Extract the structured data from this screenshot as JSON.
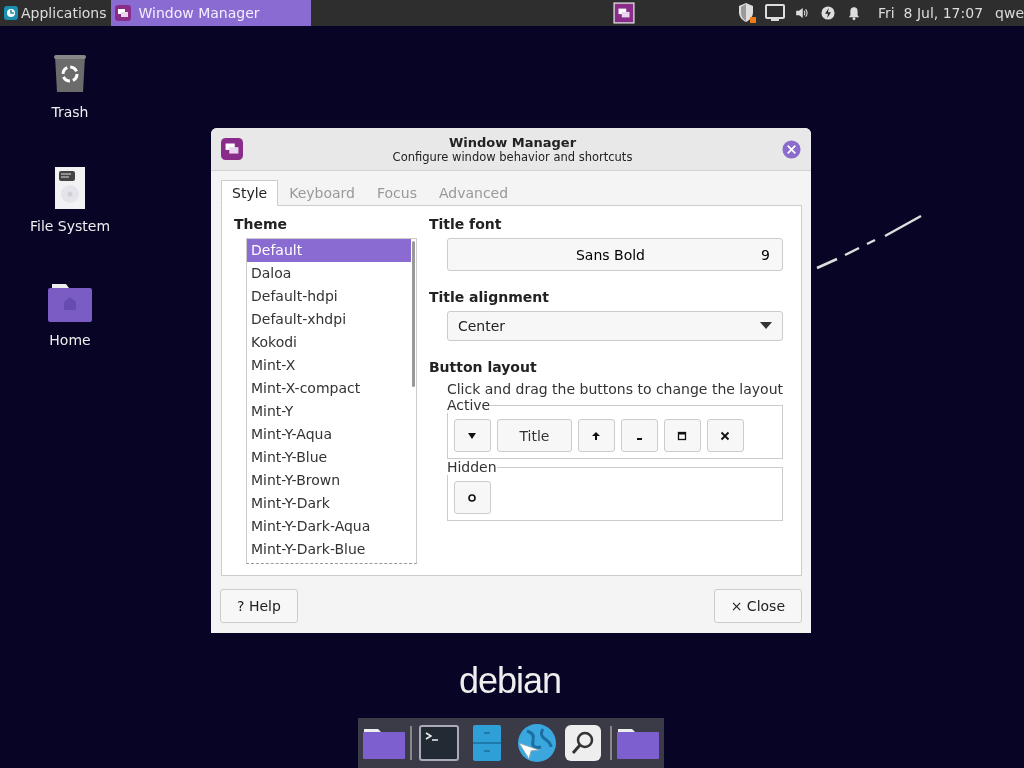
{
  "panel": {
    "applications_label": "Applications",
    "tasks": [
      {
        "title": "Window Manager",
        "selected": true
      }
    ],
    "tray": [
      {
        "kind": "shield"
      },
      {
        "kind": "display"
      },
      {
        "kind": "volume"
      },
      {
        "kind": "power"
      },
      {
        "kind": "bell"
      }
    ],
    "clock": "Fri  8 Jul, 17:07",
    "user": "qwe"
  },
  "desktop_icons": [
    {
      "label": "Trash",
      "kind": "trash"
    },
    {
      "label": "File System",
      "kind": "drive"
    },
    {
      "label": "Home",
      "kind": "home"
    }
  ],
  "dialog": {
    "title": "Window Manager",
    "subtitle": "Configure window behavior and shortcuts",
    "tabs": [
      {
        "label": "Style",
        "selected": true
      },
      {
        "label": "Keyboard",
        "selected": false
      },
      {
        "label": "Focus",
        "selected": false
      },
      {
        "label": "Advanced",
        "selected": false
      }
    ],
    "theme": {
      "heading": "Theme",
      "items": [
        {
          "label": "Default",
          "selected": true
        },
        {
          "label": "Daloa",
          "selected": false
        },
        {
          "label": "Default-hdpi",
          "selected": false
        },
        {
          "label": "Default-xhdpi",
          "selected": false
        },
        {
          "label": "Kokodi",
          "selected": false
        },
        {
          "label": "Mint-X",
          "selected": false
        },
        {
          "label": "Mint-X-compact",
          "selected": false
        },
        {
          "label": "Mint-Y",
          "selected": false
        },
        {
          "label": "Mint-Y-Aqua",
          "selected": false
        },
        {
          "label": "Mint-Y-Blue",
          "selected": false
        },
        {
          "label": "Mint-Y-Brown",
          "selected": false
        },
        {
          "label": "Mint-Y-Dark",
          "selected": false
        },
        {
          "label": "Mint-Y-Dark-Aqua",
          "selected": false
        },
        {
          "label": "Mint-Y-Dark-Blue",
          "selected": false
        }
      ]
    },
    "title_font": {
      "heading": "Title font",
      "font": "Sans Bold",
      "size": "9"
    },
    "title_alignment": {
      "heading": "Title alignment",
      "value": "Center"
    },
    "button_layout": {
      "heading": "Button layout",
      "hint": "Click and drag the buttons to change the layout",
      "active": {
        "label": "Active",
        "buttons": [
          {
            "kind": "menu"
          },
          {
            "kind": "title",
            "label": "Title"
          },
          {
            "kind": "shade"
          },
          {
            "kind": "minimize"
          },
          {
            "kind": "maximize"
          },
          {
            "kind": "close"
          }
        ]
      },
      "hidden": {
        "label": "Hidden",
        "buttons": [
          {
            "kind": "stick"
          }
        ]
      }
    },
    "help": {
      "icon": "?",
      "label": "Help"
    },
    "close": {
      "icon": "×",
      "label": "Close"
    }
  },
  "wallpaper_logo": "debian",
  "dock": [
    {
      "kind": "folder"
    },
    {
      "kind": "terminal"
    },
    {
      "kind": "files"
    },
    {
      "kind": "browser"
    },
    {
      "kind": "search"
    },
    {
      "kind": "folder"
    }
  ]
}
